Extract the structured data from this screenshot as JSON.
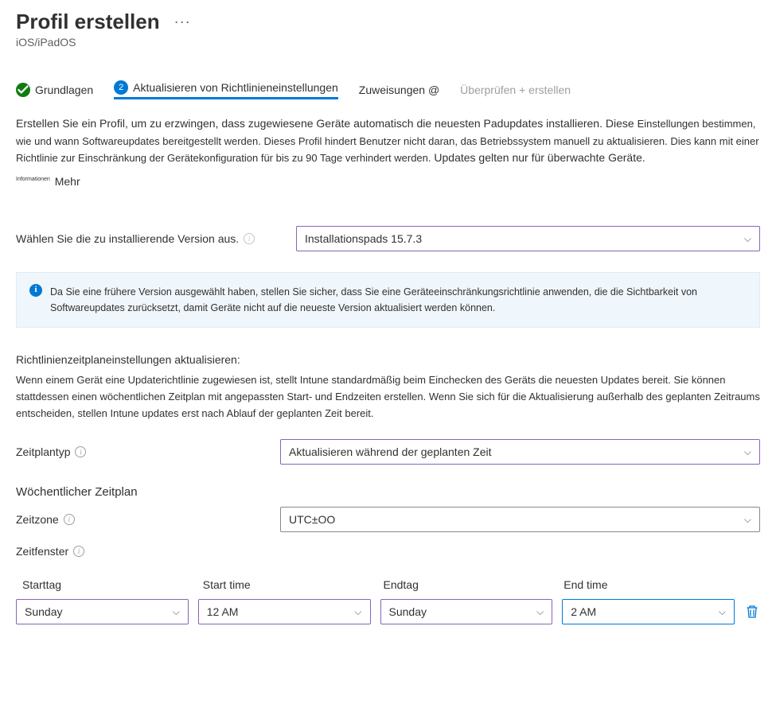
{
  "header": {
    "title": "Profil erstellen",
    "subtitle": "iOS/iPadOS"
  },
  "wizard": {
    "step1": "Grundlagen",
    "step2": "Aktualisieren von Richtlinieneinstellungen",
    "step3": "Zuweisungen @",
    "step4": "Überprüfen + erstellen"
  },
  "description": {
    "line1": "Erstellen Sie ein Profil, um zu erzwingen, dass zugewiesene Geräte automatisch die neuesten Padupdates installieren. Diese",
    "line2": "Einstellungen bestimmen, wie und wann Softwareupdates bereitgestellt werden. Dieses Profil hindert Benutzer nicht daran, das Betriebssystem manuell zu aktualisieren. Dies kann mit einer Richtlinie zur Einschränkung der Gerätekonfiguration für bis zu 90 Tage verhindert werden.",
    "line3": "Updates gelten nur für überwachte Geräte.",
    "more_tiny": "Informationen",
    "more": "Mehr"
  },
  "version": {
    "label": "Wählen Sie die zu installierende Version aus.",
    "value": "Installationspads 15.7.3"
  },
  "banner": {
    "text": "Da Sie eine frühere Version ausgewählt haben, stellen Sie sicher, dass Sie eine Geräteeinschränkungsrichtlinie anwenden, die die Sichtbarkeit von Softwareupdates zurücksetzt, damit Geräte nicht auf die neueste Version aktualisiert werden können."
  },
  "schedule": {
    "title": "Richtlinienzeitplaneinstellungen aktualisieren:",
    "desc": "Wenn einem Gerät eine Updaterichtlinie zugewiesen ist, stellt Intune standardmäßig beim Einchecken des Geräts die neuesten Updates bereit. Sie können stattdessen einen wöchentlichen Zeitplan mit angepassten Start- und Endzeiten erstellen. Wenn Sie sich für die Aktualisierung außerhalb des geplanten Zeitraums entscheiden, stellen Intune updates erst nach Ablauf der geplanten Zeit bereit.",
    "type_label": "Zeitplantyp",
    "type_value": "Aktualisieren während der geplanten Zeit",
    "weekly_title": "Wöchentlicher Zeitplan",
    "tz_label": "Zeitzone",
    "tz_value": "UTC±OO",
    "window_label": "Zeitfenster",
    "headers": {
      "startday": "Starttag",
      "starttime": "Start time",
      "endday": "Endtag",
      "endtime": "End time"
    },
    "row": {
      "startday": "Sunday",
      "starttime": "12 AM",
      "endday": "Sunday",
      "endtime": "2 AM"
    }
  }
}
